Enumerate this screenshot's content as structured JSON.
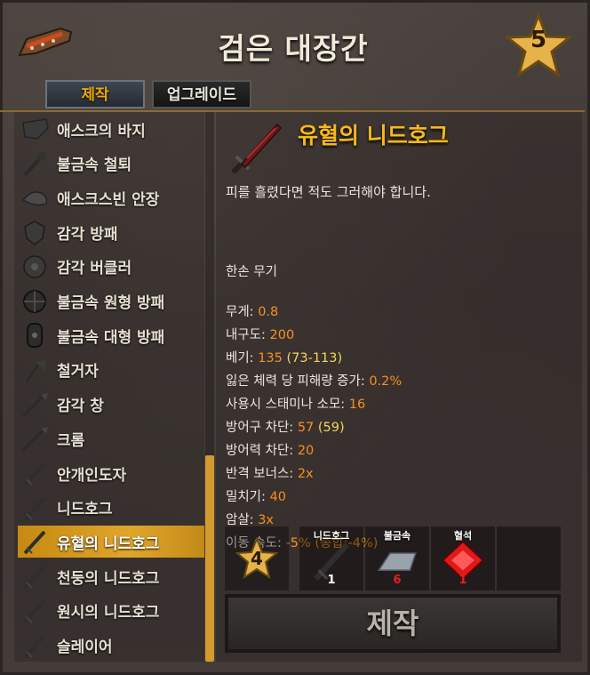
{
  "header": {
    "title": "검은 대장간",
    "level": "5"
  },
  "tabs": {
    "craft": "제작",
    "upgrade": "업그레이드"
  },
  "recipes": [
    {
      "label": "애스크의 바지",
      "icon": "pants-icon"
    },
    {
      "label": "불금속 철퇴",
      "icon": "mace-icon"
    },
    {
      "label": "애스크스빈 안장",
      "icon": "saddle-icon"
    },
    {
      "label": "감각 방패",
      "icon": "shield-icon"
    },
    {
      "label": "감각 버클러",
      "icon": "buckler-icon"
    },
    {
      "label": "불금속 원형 방패",
      "icon": "round-shield-icon"
    },
    {
      "label": "불금속 대형 방패",
      "icon": "tower-shield-icon"
    },
    {
      "label": "철거자",
      "icon": "axe-icon"
    },
    {
      "label": "감각 창",
      "icon": "spear-icon"
    },
    {
      "label": "크롬",
      "icon": "spear-icon"
    },
    {
      "label": "안개인도자",
      "icon": "sword-icon"
    },
    {
      "label": "니드호그",
      "icon": "sword-icon"
    },
    {
      "label": "유혈의 니드호그",
      "icon": "sword-icon",
      "selected": true
    },
    {
      "label": "천둥의 니드호그",
      "icon": "sword-icon"
    },
    {
      "label": "원시의 니드호그",
      "icon": "sword-icon"
    },
    {
      "label": "슬레이어",
      "icon": "sword-icon"
    }
  ],
  "item": {
    "name": "유혈의 니드호그",
    "description": "피를 흘렸다면 적도 그러해야 합니다.",
    "type": "한손 무기",
    "stats": [
      {
        "label": "무게: ",
        "value": "0.8",
        "extra": ""
      },
      {
        "label": "내구도: ",
        "value": "200",
        "extra": ""
      },
      {
        "label": "베기: ",
        "value": "135",
        "extra": " (73-113)"
      },
      {
        "label": "잃은 체력 당 피해량 증가: ",
        "value": "0.2%",
        "extra": ""
      },
      {
        "label": "사용시 스태미나 소모: ",
        "value": "16",
        "extra": ""
      },
      {
        "label": "방어구 차단: ",
        "value": "57",
        "extra": " (59)"
      },
      {
        "label": "방어력 차단: ",
        "value": "20",
        "extra": ""
      },
      {
        "label": "반격 보너스: ",
        "value": "2x",
        "extra": ""
      },
      {
        "label": "밀치기: ",
        "value": "40",
        "extra": ""
      },
      {
        "label": "암살: ",
        "value": "3x",
        "extra": ""
      },
      {
        "label": "이동 속도: ",
        "value": "-5% (총합:-4%)",
        "extra": ""
      }
    ]
  },
  "requirements": {
    "station_level": "4",
    "materials": [
      {
        "name": "니드호그",
        "qty": "1",
        "qty_color": "#ffffff",
        "icon": "sword-icon"
      },
      {
        "name": "불금속",
        "qty": "6",
        "qty_color": "#e02020",
        "icon": "metal-bar-icon"
      },
      {
        "name": "혈석",
        "qty": "1",
        "qty_color": "#e02020",
        "icon": "bloodstone-icon"
      }
    ]
  },
  "craft_button": "제작",
  "colors": {
    "accent": "#f6b81c",
    "value": "#f59020",
    "selected_row": "#d99c1e"
  }
}
